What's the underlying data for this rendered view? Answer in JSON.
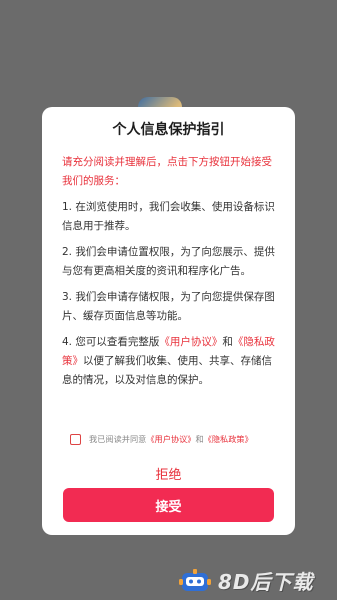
{
  "dialog": {
    "title": "个人信息保护指引",
    "intro": "请充分阅读并理解后，点击下方按钮开始接受我们的服务：",
    "items": [
      "1. 在浏览使用时，我们会收集、使用设备标识信息用于推荐。",
      "2. 我们会申请位置权限，为了向您展示、提供与您有更高相关度的资讯和程序化广告。",
      "3. 我们会申请存储权限，为了向您提供保存图片、缓存页面信息等功能。"
    ],
    "item4": {
      "prefix": "4. 您可以查看完整版",
      "user_agreement": "《用户协议》",
      "and": "和",
      "privacy_policy": "《隐私政策》",
      "suffix": "以便了解我们收集、使用、共享、存储信息的情况，以及对信息的保护。"
    },
    "consent": {
      "prefix": "我已阅读并同意",
      "user_agreement": "《用户协议》",
      "and": "和",
      "privacy_policy": "《隐私政策》",
      "checked": false
    },
    "decline_label": "拒绝",
    "accept_label": "接受"
  },
  "watermark": {
    "text": "8D后下载",
    "icon": "robot-icon"
  },
  "colors": {
    "accent": "#f22b52",
    "link": "#e8323c",
    "backdrop": "#6b6b6b"
  }
}
